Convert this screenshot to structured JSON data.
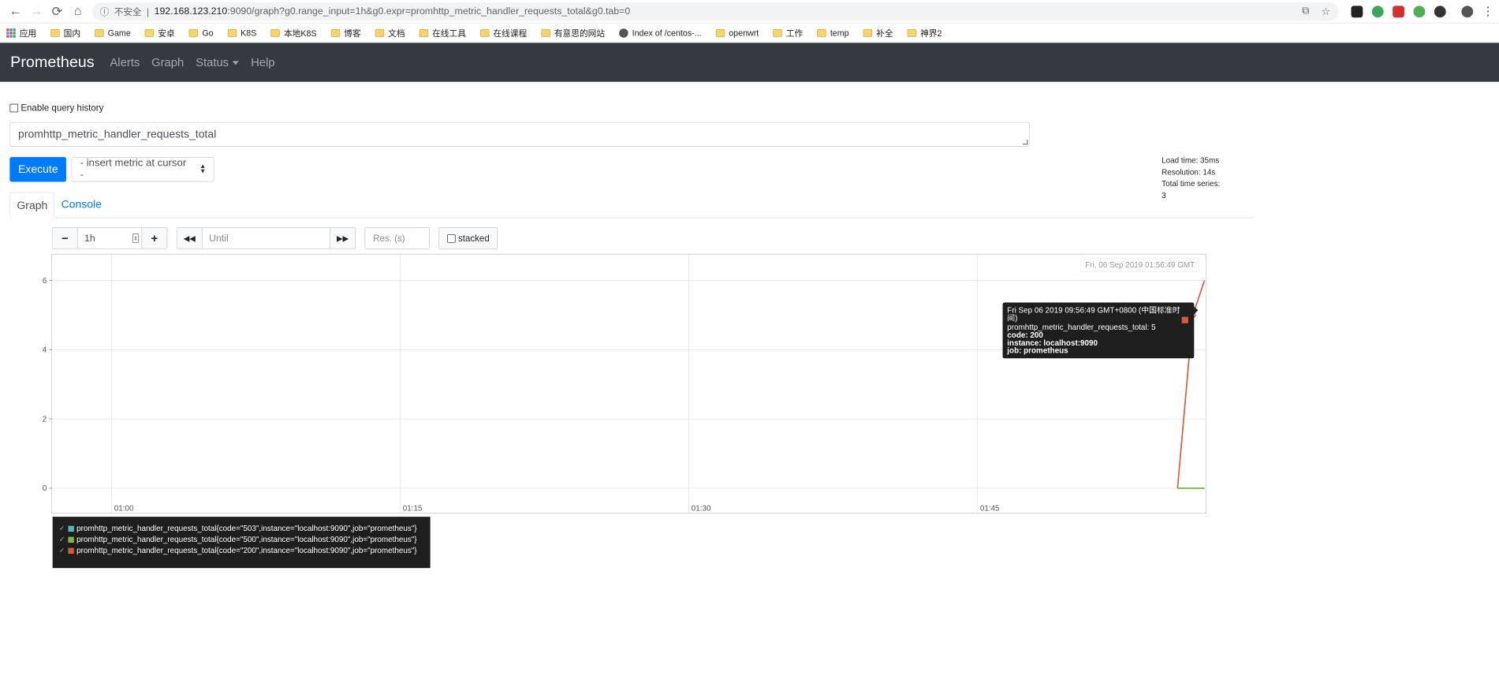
{
  "browser": {
    "security_label": "不安全",
    "url_host": "192.168.123.210",
    "url_rest": ":9090/graph?g0.range_input=1h&g0.expr=promhttp_metric_handler_requests_total&g0.tab=0",
    "bookmarks": [
      "应用",
      "国内",
      "Game",
      "安卓",
      "Go",
      "K8S",
      "本地K8S",
      "博客",
      "文档",
      "在线工具",
      "在线课程",
      "有意思的网站",
      "Index of /centos-...",
      "openwrt",
      "工作",
      "temp",
      "补全",
      "神界2"
    ]
  },
  "navbar": {
    "brand": "Prometheus",
    "links": [
      "Alerts",
      "Graph",
      "Status",
      "Help"
    ]
  },
  "query": {
    "history_label": "Enable query history",
    "expression": "promhttp_metric_handler_requests_total",
    "execute_label": "Execute",
    "metric_select": "- insert metric at cursor -",
    "stats": {
      "load_time": "Load time: 35ms",
      "resolution": "Resolution: 14s",
      "total_series": "Total time series: 3"
    }
  },
  "tabs": [
    "Graph",
    "Console"
  ],
  "controls": {
    "minus": "−",
    "range": "1h",
    "plus": "+",
    "rewind": "◀◀",
    "until_placeholder": "Until",
    "forward": "▶▶",
    "res_placeholder": "Res. (s)",
    "stacked_label": "stacked"
  },
  "graph": {
    "timestamp_badge": "Fri, 06 Sep 2019 01:56:49 GMT",
    "tooltip": {
      "time": "Fri Sep 06 2019 09:56:49 GMT+0800 (中国标准时间)",
      "metric": "promhttp_metric_handler_requests_total: 5",
      "code": "code: 200",
      "instance": "instance: localhost:9090",
      "job": "job: prometheus"
    }
  },
  "chart_data": {
    "type": "line",
    "x_ticks": [
      "01:00",
      "01:15",
      "01:30",
      "01:45"
    ],
    "y_ticks": [
      0,
      2,
      4,
      6
    ],
    "ylim": [
      0,
      6.6
    ],
    "x_range_minutes": [
      56.9,
      116.8
    ],
    "series": [
      {
        "name": "promhttp_metric_handler_requests_total{code=\"503\",instance=\"localhost:9090\",job=\"prometheus\"}",
        "color": "#5ab4bb",
        "points": [
          [
            115.4,
            0
          ],
          [
            116.8,
            0
          ]
        ]
      },
      {
        "name": "promhttp_metric_handler_requests_total{code=\"500\",instance=\"localhost:9090\",job=\"prometheus\"}",
        "color": "#7fb93b",
        "points": [
          [
            115.4,
            0
          ],
          [
            116.8,
            0
          ]
        ]
      },
      {
        "name": "promhttp_metric_handler_requests_total{code=\"200\",instance=\"localhost:9090\",job=\"prometheus\"}",
        "color": "#d75a34",
        "points": [
          [
            115.4,
            0
          ],
          [
            116.2,
            5
          ],
          [
            116.8,
            6
          ]
        ]
      }
    ]
  }
}
